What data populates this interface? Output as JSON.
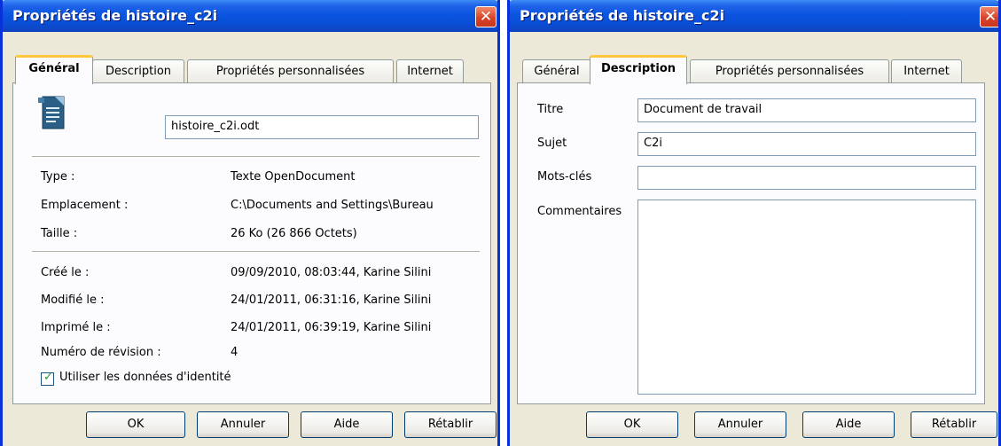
{
  "left_dialog": {
    "title": "Propriétés de histoire_c2i",
    "close_glyph": "✕",
    "tabs": [
      "Général",
      "Description",
      "Propriétés personnalisées",
      "Internet"
    ],
    "active_tab": "Général",
    "icon": "document-icon",
    "filename": "histoire_c2i.odt",
    "rows": [
      {
        "label": "Type :",
        "value": "Texte OpenDocument"
      },
      {
        "label": "Emplacement :",
        "value": "C:\\Documents and Settings\\Bureau"
      },
      {
        "label": "Taille :",
        "value": "26 Ko (26 866 Octets)"
      },
      {
        "label": "Créé le :",
        "value": "09/09/2010, 08:03:44, Karine Silini"
      },
      {
        "label": "Modifié le :",
        "value": "24/01/2011, 06:31:16, Karine Silini"
      },
      {
        "label": "Imprimé le :",
        "value": "24/01/2011, 06:39:19, Karine Silini"
      },
      {
        "label": "Numéro de révision :",
        "value": "4"
      }
    ],
    "checkbox": {
      "label": "Utiliser les données d'identité",
      "checked": true
    },
    "buttons": {
      "ok": "OK",
      "cancel": "Annuler",
      "help": "Aide",
      "reset": "Rétablir"
    }
  },
  "right_dialog": {
    "title": "Propriétés de histoire_c2i",
    "close_glyph": "✕",
    "tabs": [
      "Général",
      "Description",
      "Propriétés personnalisées",
      "Internet"
    ],
    "active_tab": "Description",
    "fields": [
      {
        "label": "Titre",
        "value": "Document de travail"
      },
      {
        "label": "Sujet",
        "value": "C2i"
      },
      {
        "label": "Mots-clés",
        "value": ""
      },
      {
        "label": "Commentaires",
        "value": ""
      }
    ],
    "buttons": {
      "ok": "OK",
      "cancel": "Annuler",
      "help": "Aide",
      "reset": "Rétablir"
    }
  },
  "colors": {
    "titlebar": "#0a4fd8",
    "dialog_bg": "#ece9d8",
    "active_tab_accent": "#ffc83c",
    "close_button": "#d9432a"
  }
}
